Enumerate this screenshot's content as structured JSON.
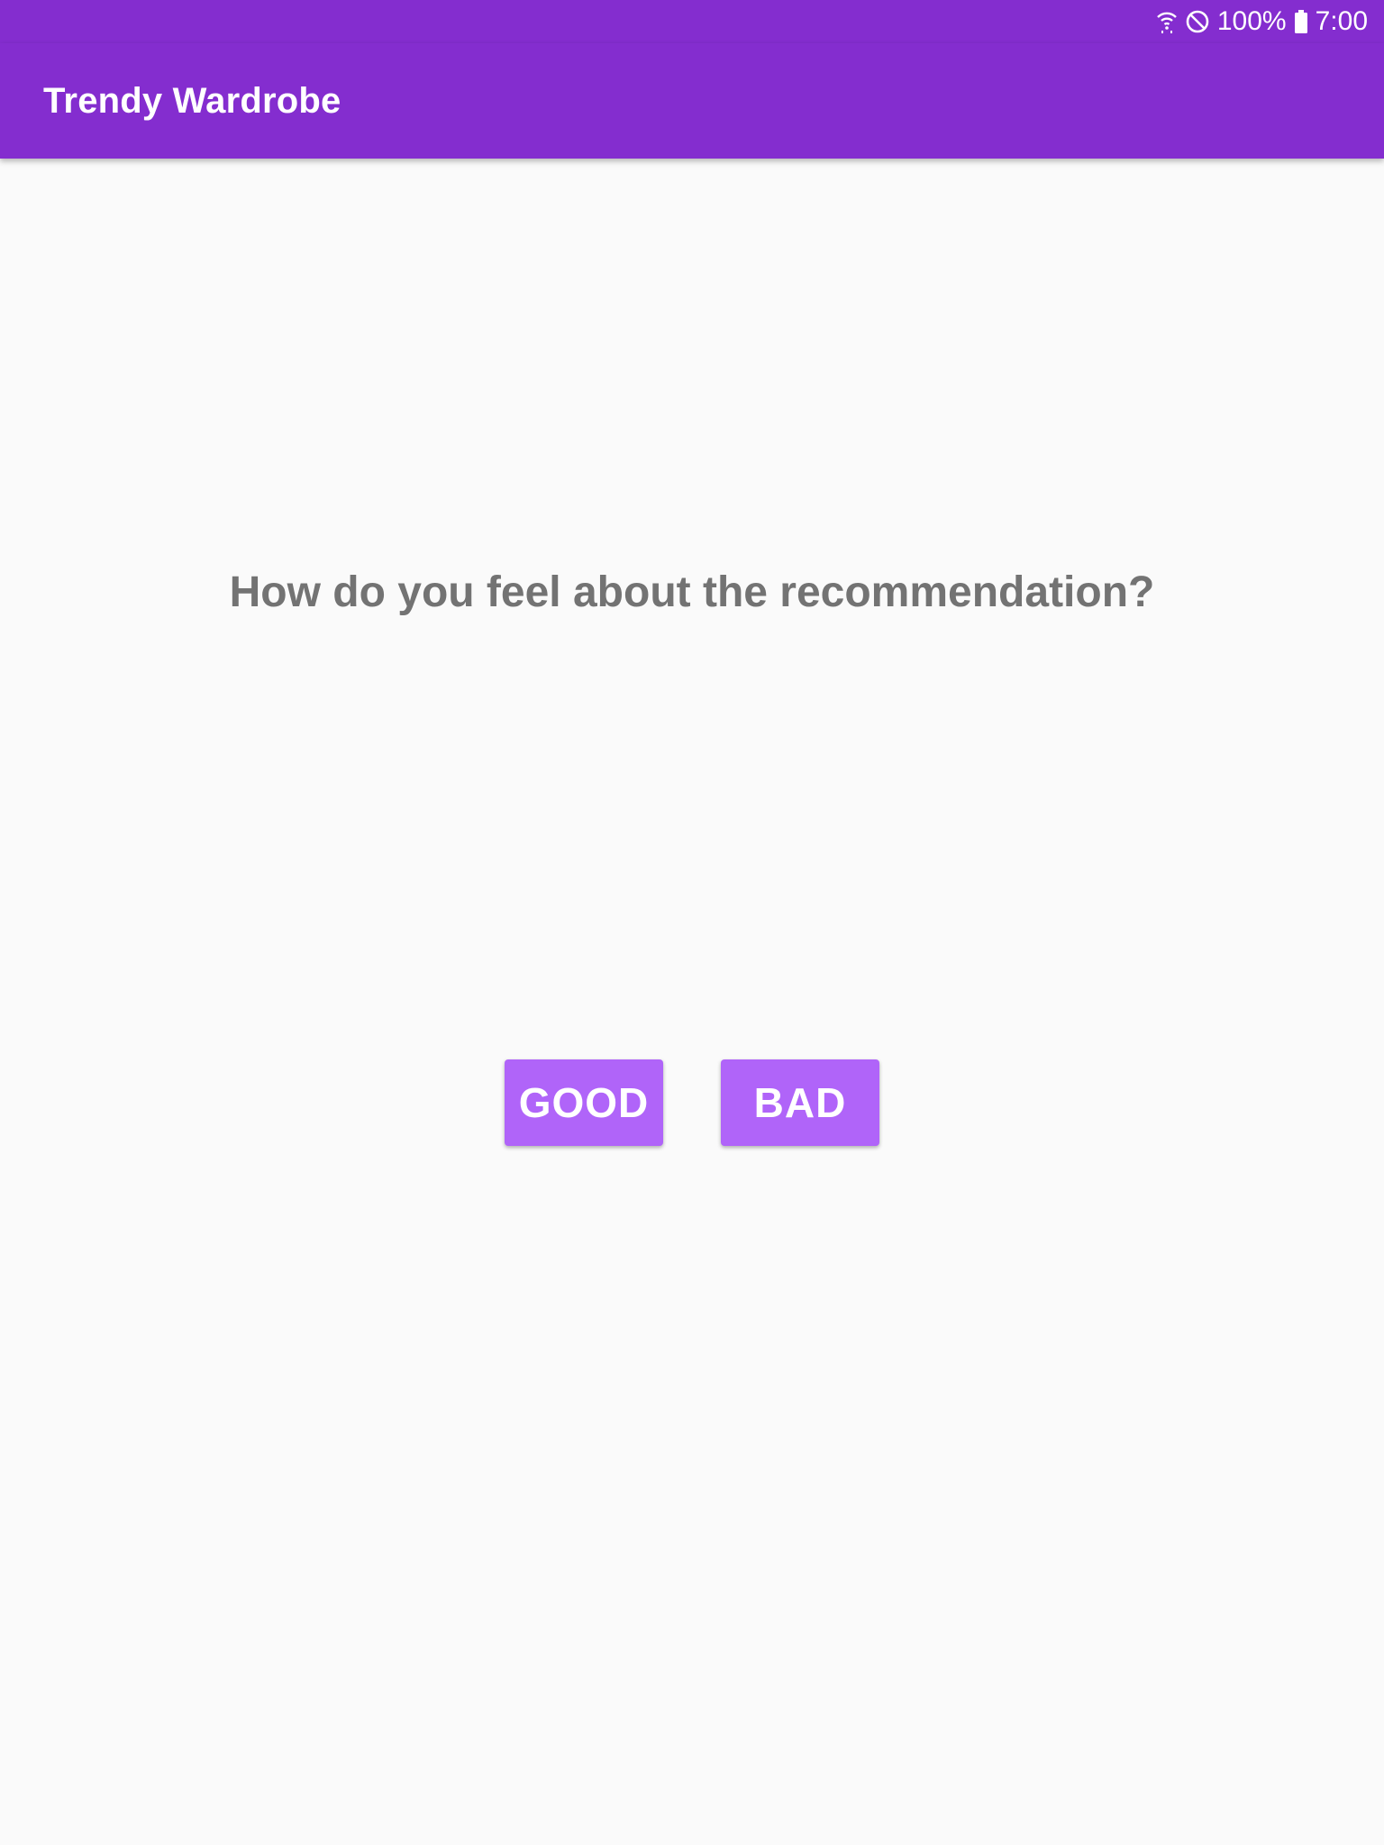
{
  "status_bar": {
    "wifi_icon": "wifi-icon",
    "dnd_icon": "do-not-disturb-icon",
    "battery_percent": "100%",
    "battery_icon": "battery-icon",
    "time": "7:00"
  },
  "app_bar": {
    "title": "Trendy Wardrobe",
    "color": "#842dcf"
  },
  "main": {
    "question": "How do you feel about the recommendation?",
    "good_label": "GOOD",
    "bad_label": "BAD",
    "button_color": "#b064f9"
  }
}
